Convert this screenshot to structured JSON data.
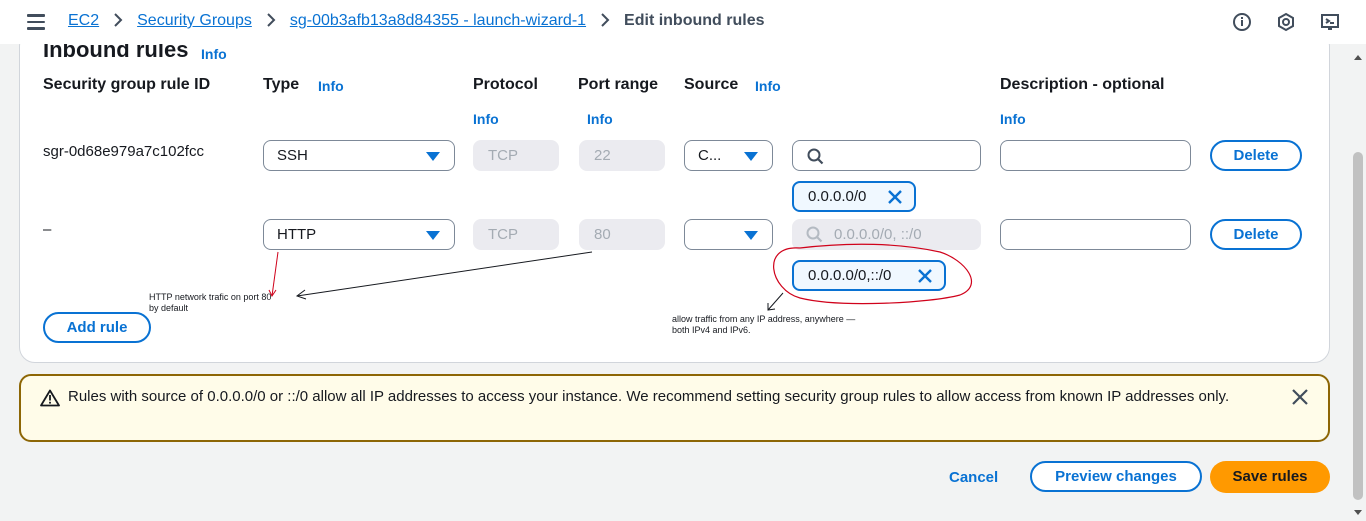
{
  "breadcrumb": {
    "items": [
      "EC2",
      "Security Groups",
      "sg-00b3afb13a8d84355 - launch-wizard-1"
    ],
    "separator": ">",
    "current": "Edit inbound rules"
  },
  "header_icons": [
    "info-circle-icon",
    "settings-hexagon-icon",
    "cloudshell-icon"
  ],
  "section": {
    "title": "Inbound rules",
    "info": "Info"
  },
  "columns": {
    "rule_id": "Security group rule ID",
    "type": "Type",
    "protocol": "Protocol",
    "port_range": "Port range",
    "source": "Source",
    "description": "Description - optional",
    "info": "Info"
  },
  "rules": [
    {
      "id": "sgr-0d68e979a7c102fcc",
      "type": "SSH",
      "protocol": "TCP",
      "port": "22",
      "source_type": "C...",
      "source_search_placeholder": "",
      "token": "0.0.0.0/0",
      "description": "",
      "delete": "Delete"
    },
    {
      "id": "–",
      "type": "HTTP",
      "protocol": "TCP",
      "port": "80",
      "source_type": "",
      "source_search_placeholder": "0.0.0.0/0, ::/0",
      "token": "0.0.0.0/0,::/0",
      "description": "",
      "delete": "Delete"
    }
  ],
  "add_rule": "Add rule",
  "annotations": {
    "http_note_line1": "HTTP network trafic on port 80",
    "http_note_line2": "by default",
    "source_note_line1": "allow traffic from any IP address, anywhere —",
    "source_note_line2": "both IPv4 and IPv6."
  },
  "alert": {
    "text": "Rules with source of 0.0.0.0/0 or ::/0 allow all IP addresses to access your instance. We recommend setting security group rules to allow access from known IP addresses only."
  },
  "footer": {
    "cancel": "Cancel",
    "preview": "Preview changes",
    "save": "Save rules"
  },
  "colors": {
    "link_blue": "#0972d3",
    "primary_orange": "#ff9900",
    "warning_border": "#8d6605",
    "annotation_red": "#d0021b"
  }
}
